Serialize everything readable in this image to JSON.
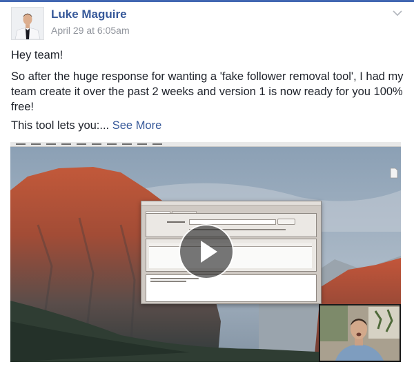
{
  "post": {
    "author": "Luke Maguire",
    "timestamp": "April 29 at 6:05am",
    "greeting": "Hey team!",
    "body": "So after the huge response for wanting a 'fake follower removal tool', I had my team create it over the past 2 weeks and version 1 is now ready for you 100% free!",
    "teaser": "This tool lets you:...",
    "see_more": "See More"
  },
  "icons": {
    "options": "chevron-down-icon",
    "play": "play-icon",
    "avatar": "user-photo"
  },
  "colors": {
    "brand_blue": "#4267b2",
    "link": "#365899",
    "meta_gray": "#90949c",
    "body_text": "#1d2129"
  }
}
